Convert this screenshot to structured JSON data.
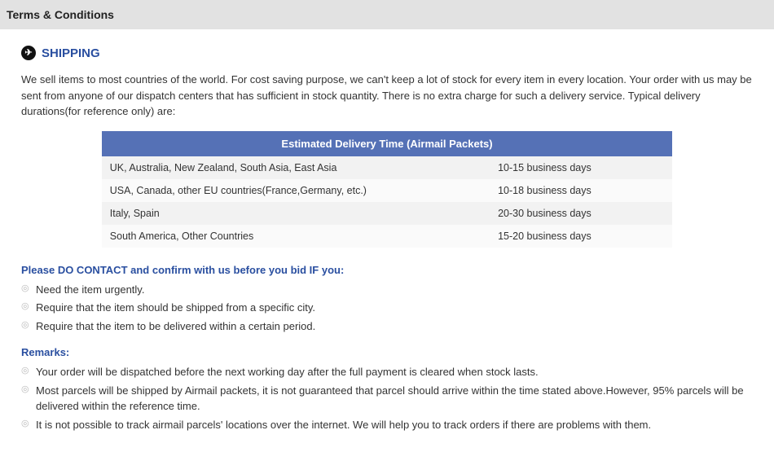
{
  "header": {
    "title": "Terms & Conditions"
  },
  "shipping": {
    "title": "SHIPPING",
    "intro": "We sell items to most countries of the world. For cost saving purpose, we can't keep a lot of stock for every item in every location. Your order with us may be sent from anyone of our dispatch centers that has sufficient in stock quantity. There is no extra charge for such a delivery service. Typical delivery durations(for reference only) are:",
    "table": {
      "header": "Estimated Delivery Time (Airmail Packets)",
      "rows": [
        {
          "region": "UK, Australia, New Zealand, South Asia, East Asia",
          "time": "10-15 business days"
        },
        {
          "region": "USA, Canada, other EU countries(France,Germany, etc.)",
          "time": "10-18 business days"
        },
        {
          "region": "Italy, Spain",
          "time": "20-30 business days"
        },
        {
          "region": "South America, Other Countries",
          "time": "15-20 business days"
        }
      ]
    },
    "contact_heading": "Please DO CONTACT and confirm with us before you bid IF you:",
    "contact_items": [
      "Need the item urgently.",
      "Require that the item should be shipped from a specific city.",
      "Require that the item to be delivered within a certain period."
    ],
    "remarks_heading": "Remarks:",
    "remarks_items": [
      "Your order will be dispatched before the next working day after the full payment is cleared when stock lasts.",
      "Most parcels will be shipped by Airmail packets, it is not guaranteed that parcel should arrive within the time stated above.However, 95% parcels will be delivered within the reference time.",
      "It is not possible to track airmail parcels' locations over the internet. We will help you to track orders if there are problems with them."
    ]
  }
}
